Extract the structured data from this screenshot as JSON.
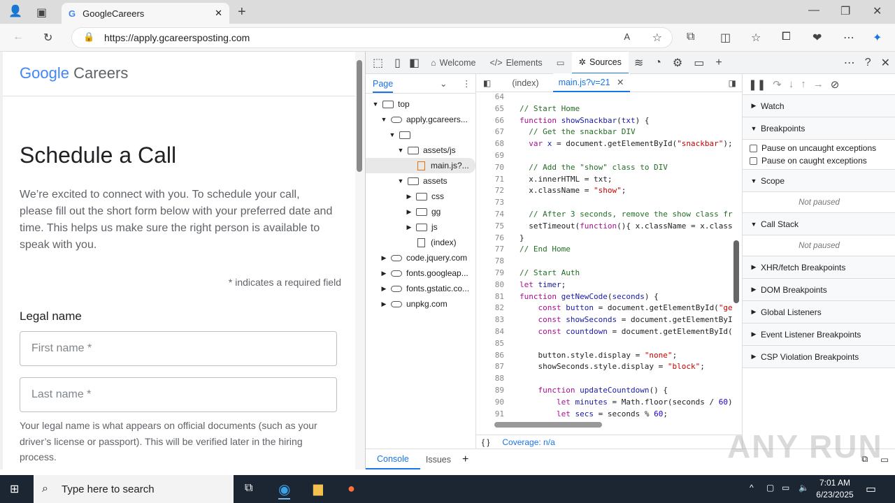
{
  "browser": {
    "tab_title": "GoogleCareers",
    "url": "https://apply.gcareersposting.com"
  },
  "page": {
    "logo_google": "Google",
    "logo_careers": "Careers",
    "title": "Schedule a Call",
    "intro": "We’re excited to connect with you. To schedule your call, please fill out the short form below with your preferred date and time. This helps us make sure the right person is available to speak with you.",
    "required_note": "* indicates a required field",
    "legal_name_label": "Legal name",
    "first_name_placeholder": "First name *",
    "last_name_placeholder": "Last name *",
    "help_text": "Your legal name is what appears on official documents (such as your driver’s license or passport). This will be verified later in the hiring process."
  },
  "devtools": {
    "tabs": [
      "Welcome",
      "Elements",
      "Sources"
    ],
    "active_tab": "Sources",
    "navigator": {
      "header": "Page",
      "tree": [
        {
          "label": "top",
          "depth": 0,
          "icon": "frame",
          "open": true
        },
        {
          "label": "apply.gcareers...",
          "depth": 1,
          "icon": "cloud",
          "open": true
        },
        {
          "label": "",
          "depth": 2,
          "icon": "folder",
          "open": true
        },
        {
          "label": "assets/js",
          "depth": 3,
          "icon": "folder",
          "open": true
        },
        {
          "label": "main.js?...",
          "depth": 4,
          "icon": "file",
          "selected": true
        },
        {
          "label": "assets",
          "depth": 3,
          "icon": "folder",
          "open": true
        },
        {
          "label": "css",
          "depth": 4,
          "icon": "folder",
          "open": false
        },
        {
          "label": "gg",
          "depth": 4,
          "icon": "folder",
          "open": false
        },
        {
          "label": "js",
          "depth": 4,
          "icon": "folder",
          "open": false
        },
        {
          "label": "(index)",
          "depth": 4,
          "icon": "file"
        },
        {
          "label": "code.jquery.com",
          "depth": 1,
          "icon": "cloud",
          "open": false
        },
        {
          "label": "fonts.googleap...",
          "depth": 1,
          "icon": "cloud",
          "open": false
        },
        {
          "label": "fonts.gstatic.co...",
          "depth": 1,
          "icon": "cloud",
          "open": false
        },
        {
          "label": "unpkg.com",
          "depth": 1,
          "icon": "cloud",
          "open": false
        }
      ]
    },
    "editor_tabs": [
      "(index)",
      "main.js?v=21"
    ],
    "code": [
      {
        "n": "64",
        "t": []
      },
      {
        "n": "65",
        "t": [
          [
            "cm",
            "// Start Home"
          ]
        ]
      },
      {
        "n": "66",
        "t": [
          [
            "kw",
            "function "
          ],
          [
            "id",
            "showSnackbar"
          ],
          [
            "pl",
            "("
          ],
          [
            "id",
            "txt"
          ],
          [
            "pl",
            ") {"
          ]
        ]
      },
      {
        "n": "67",
        "t": [
          [
            "pl",
            "  "
          ],
          [
            "cm",
            "// Get the snackbar DIV"
          ]
        ]
      },
      {
        "n": "68",
        "t": [
          [
            "pl",
            "  "
          ],
          [
            "kw",
            "var "
          ],
          [
            "id",
            "x"
          ],
          [
            "pl",
            " = document.getElementById("
          ],
          [
            "st",
            "\"snackbar\""
          ],
          [
            "pl",
            ");"
          ]
        ]
      },
      {
        "n": "69",
        "t": []
      },
      {
        "n": "70",
        "t": [
          [
            "pl",
            "  "
          ],
          [
            "cm",
            "// Add the \"show\" class to DIV"
          ]
        ]
      },
      {
        "n": "71",
        "t": [
          [
            "pl",
            "  x.innerHTML = txt;"
          ]
        ]
      },
      {
        "n": "72",
        "t": [
          [
            "pl",
            "  x.className = "
          ],
          [
            "st",
            "\"show\""
          ],
          [
            "pl",
            ";"
          ]
        ]
      },
      {
        "n": "73",
        "t": []
      },
      {
        "n": "74",
        "t": [
          [
            "pl",
            "  "
          ],
          [
            "cm",
            "// After 3 seconds, remove the show class fr"
          ]
        ]
      },
      {
        "n": "75",
        "t": [
          [
            "pl",
            "  setTimeout("
          ],
          [
            "kw",
            "function"
          ],
          [
            "pl",
            "(){ x.className = x.class"
          ]
        ]
      },
      {
        "n": "76",
        "t": [
          [
            "pl",
            "}"
          ]
        ]
      },
      {
        "n": "77",
        "t": [
          [
            "cm",
            "// End Home"
          ]
        ]
      },
      {
        "n": "78",
        "t": []
      },
      {
        "n": "79",
        "t": [
          [
            "cm",
            "// Start Auth"
          ]
        ]
      },
      {
        "n": "80",
        "t": [
          [
            "kw",
            "let "
          ],
          [
            "id",
            "timer"
          ],
          [
            "pl",
            ";"
          ]
        ]
      },
      {
        "n": "81",
        "t": [
          [
            "kw",
            "function "
          ],
          [
            "id",
            "getNewCode"
          ],
          [
            "pl",
            "("
          ],
          [
            "id",
            "seconds"
          ],
          [
            "pl",
            ") {"
          ]
        ]
      },
      {
        "n": "82",
        "t": [
          [
            "pl",
            "    "
          ],
          [
            "kw",
            "const "
          ],
          [
            "id",
            "button"
          ],
          [
            "pl",
            " = document.getElementById("
          ],
          [
            "st",
            "\"ge"
          ]
        ]
      },
      {
        "n": "83",
        "t": [
          [
            "pl",
            "    "
          ],
          [
            "kw",
            "const "
          ],
          [
            "id",
            "showSeconds"
          ],
          [
            "pl",
            " = document.getElementByI"
          ]
        ]
      },
      {
        "n": "84",
        "t": [
          [
            "pl",
            "    "
          ],
          [
            "kw",
            "const "
          ],
          [
            "id",
            "countdown"
          ],
          [
            "pl",
            " = document.getElementById("
          ]
        ]
      },
      {
        "n": "85",
        "t": []
      },
      {
        "n": "86",
        "t": [
          [
            "pl",
            "    button.style.display = "
          ],
          [
            "st",
            "\"none\""
          ],
          [
            "pl",
            ";"
          ]
        ]
      },
      {
        "n": "87",
        "t": [
          [
            "pl",
            "    showSeconds.style.display = "
          ],
          [
            "st",
            "\"block\""
          ],
          [
            "pl",
            ";"
          ]
        ]
      },
      {
        "n": "88",
        "t": []
      },
      {
        "n": "89",
        "t": [
          [
            "pl",
            "    "
          ],
          [
            "kw",
            "function "
          ],
          [
            "id",
            "updateCountdown"
          ],
          [
            "pl",
            "() {"
          ]
        ]
      },
      {
        "n": "90",
        "t": [
          [
            "pl",
            "        "
          ],
          [
            "kw",
            "let "
          ],
          [
            "id",
            "minutes"
          ],
          [
            "pl",
            " = Math.floor(seconds / "
          ],
          [
            "nm",
            "60"
          ],
          [
            "pl",
            ")"
          ]
        ]
      },
      {
        "n": "91",
        "t": [
          [
            "pl",
            "        "
          ],
          [
            "kw",
            "let "
          ],
          [
            "id",
            "secs"
          ],
          [
            "pl",
            " = seconds % "
          ],
          [
            "nm",
            "60"
          ],
          [
            "pl",
            ";"
          ]
        ]
      }
    ],
    "status_braces": "{ }",
    "coverage": "Coverage: n/a",
    "debugger": {
      "watch": "Watch",
      "breakpoints": "Breakpoints",
      "pause_uncaught": "Pause on uncaught exceptions",
      "pause_caught": "Pause on caught exceptions",
      "scope": "Scope",
      "not_paused": "Not paused",
      "call_stack": "Call Stack",
      "more": [
        "XHR/fetch Breakpoints",
        "DOM Breakpoints",
        "Global Listeners",
        "Event Listener Breakpoints",
        "CSP Violation Breakpoints"
      ]
    },
    "drawer": [
      "Console",
      "Issues"
    ]
  },
  "taskbar": {
    "search_placeholder": "Type here to search",
    "time": "7:01 AM",
    "date": "6/23/2025"
  },
  "watermark": "ANY RUN"
}
